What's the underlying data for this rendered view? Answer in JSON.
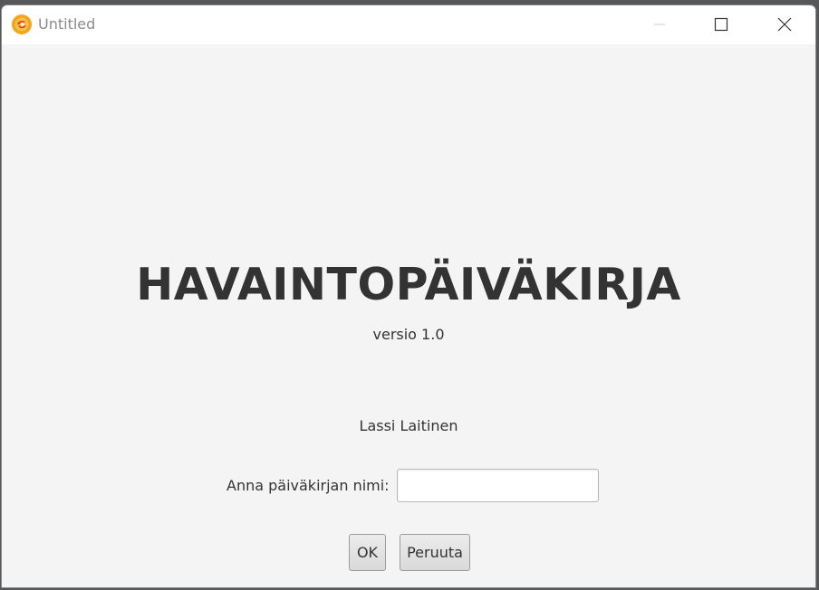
{
  "window": {
    "title": "Untitled",
    "controls": [
      "minimize-icon",
      "maximize-icon",
      "close-icon"
    ]
  },
  "main": {
    "app_title": "HAVAINTOPÄIVÄKIRJA",
    "version": "versio 1.0",
    "author": "Lassi Laitinen",
    "name_label": "Anna päiväkirjan nimi:",
    "name_value": "",
    "ok_label": "OK",
    "cancel_label": "Peruuta"
  },
  "colors": {
    "background": "#f4f4f4",
    "text": "#333333",
    "icon_accent": "#f5a31a"
  }
}
